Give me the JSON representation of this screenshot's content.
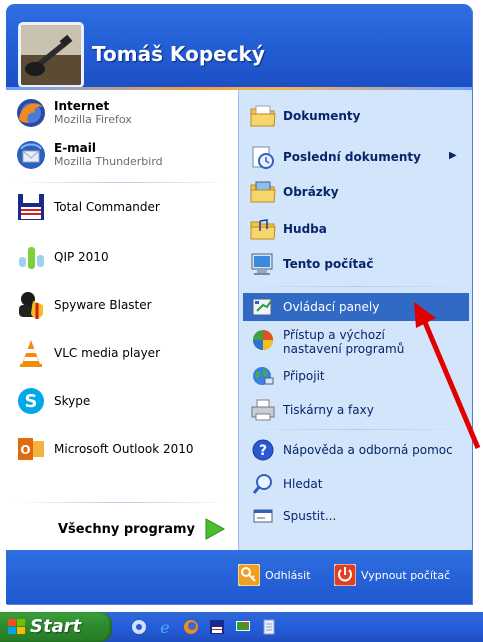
{
  "user": {
    "name": "Tomáš Kopecký"
  },
  "left_pinned": [
    {
      "title": "Internet",
      "subtitle": "Mozilla Firefox",
      "icon": "firefox-icon"
    },
    {
      "title": "E-mail",
      "subtitle": "Mozilla Thunderbird",
      "icon": "thunderbird-icon"
    }
  ],
  "left_recent": [
    {
      "label": "Total Commander",
      "icon": "floppy-icon"
    },
    {
      "label": "QIP 2010",
      "icon": "qip-icon"
    },
    {
      "label": "Spyware Blaster",
      "icon": "spyware-blaster-icon"
    },
    {
      "label": "VLC media player",
      "icon": "vlc-cone-icon"
    },
    {
      "label": "Skype",
      "icon": "skype-icon"
    },
    {
      "label": "Microsoft Outlook 2010",
      "icon": "outlook-icon"
    }
  ],
  "all_programs": {
    "label": "Všechny programy"
  },
  "right_items": [
    {
      "label": "Dokumenty",
      "bold": true,
      "icon": "documents-folder-icon"
    },
    {
      "label": "Poslední dokumenty",
      "bold": true,
      "icon": "recent-documents-icon",
      "submenu": true
    },
    {
      "label": "Obrázky",
      "bold": true,
      "icon": "pictures-folder-icon"
    },
    {
      "label": "Hudba",
      "bold": true,
      "icon": "music-folder-icon"
    },
    {
      "label": "Tento počítač",
      "bold": true,
      "icon": "my-computer-icon"
    },
    {
      "label": "Ovládací panely",
      "bold": false,
      "icon": "control-panel-icon",
      "highlighted": true
    },
    {
      "label": "Přístup a výchozí nastavení programů",
      "bold": false,
      "icon": "program-access-icon"
    },
    {
      "label": "Připojit",
      "bold": false,
      "icon": "connect-globe-icon",
      "submenu": true
    },
    {
      "label": "Tiskárny a faxy",
      "bold": false,
      "icon": "printer-icon"
    },
    {
      "label": "Nápověda a odborná pomoc",
      "bold": false,
      "icon": "help-icon"
    },
    {
      "label": "Hledat",
      "bold": false,
      "icon": "search-icon"
    },
    {
      "label": "Spustit...",
      "bold": false,
      "icon": "run-icon"
    }
  ],
  "footer": {
    "logoff_label": "Odhlásit",
    "shutdown_label": "Vypnout počítač"
  },
  "taskbar": {
    "start_label": "Start"
  },
  "colors": {
    "xp_blue": "#245fd6",
    "panel_right": "#d3e5fa",
    "highlight": "#316ac5",
    "start_green": "#2d8a2d",
    "arrow_red": "#e00000"
  }
}
